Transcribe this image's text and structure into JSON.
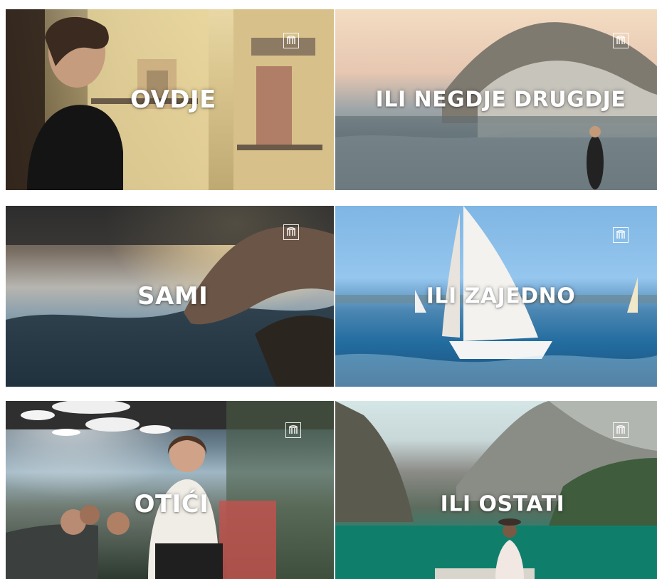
{
  "tiles": [
    {
      "caption": "OVDJE"
    },
    {
      "caption": "ILI NEGDJE DRUGDJE"
    },
    {
      "caption": "SAMI"
    },
    {
      "caption": "ILI ZAJEDNO"
    },
    {
      "caption": "OTIĆI"
    },
    {
      "caption": "ILI OSTATI"
    }
  ]
}
